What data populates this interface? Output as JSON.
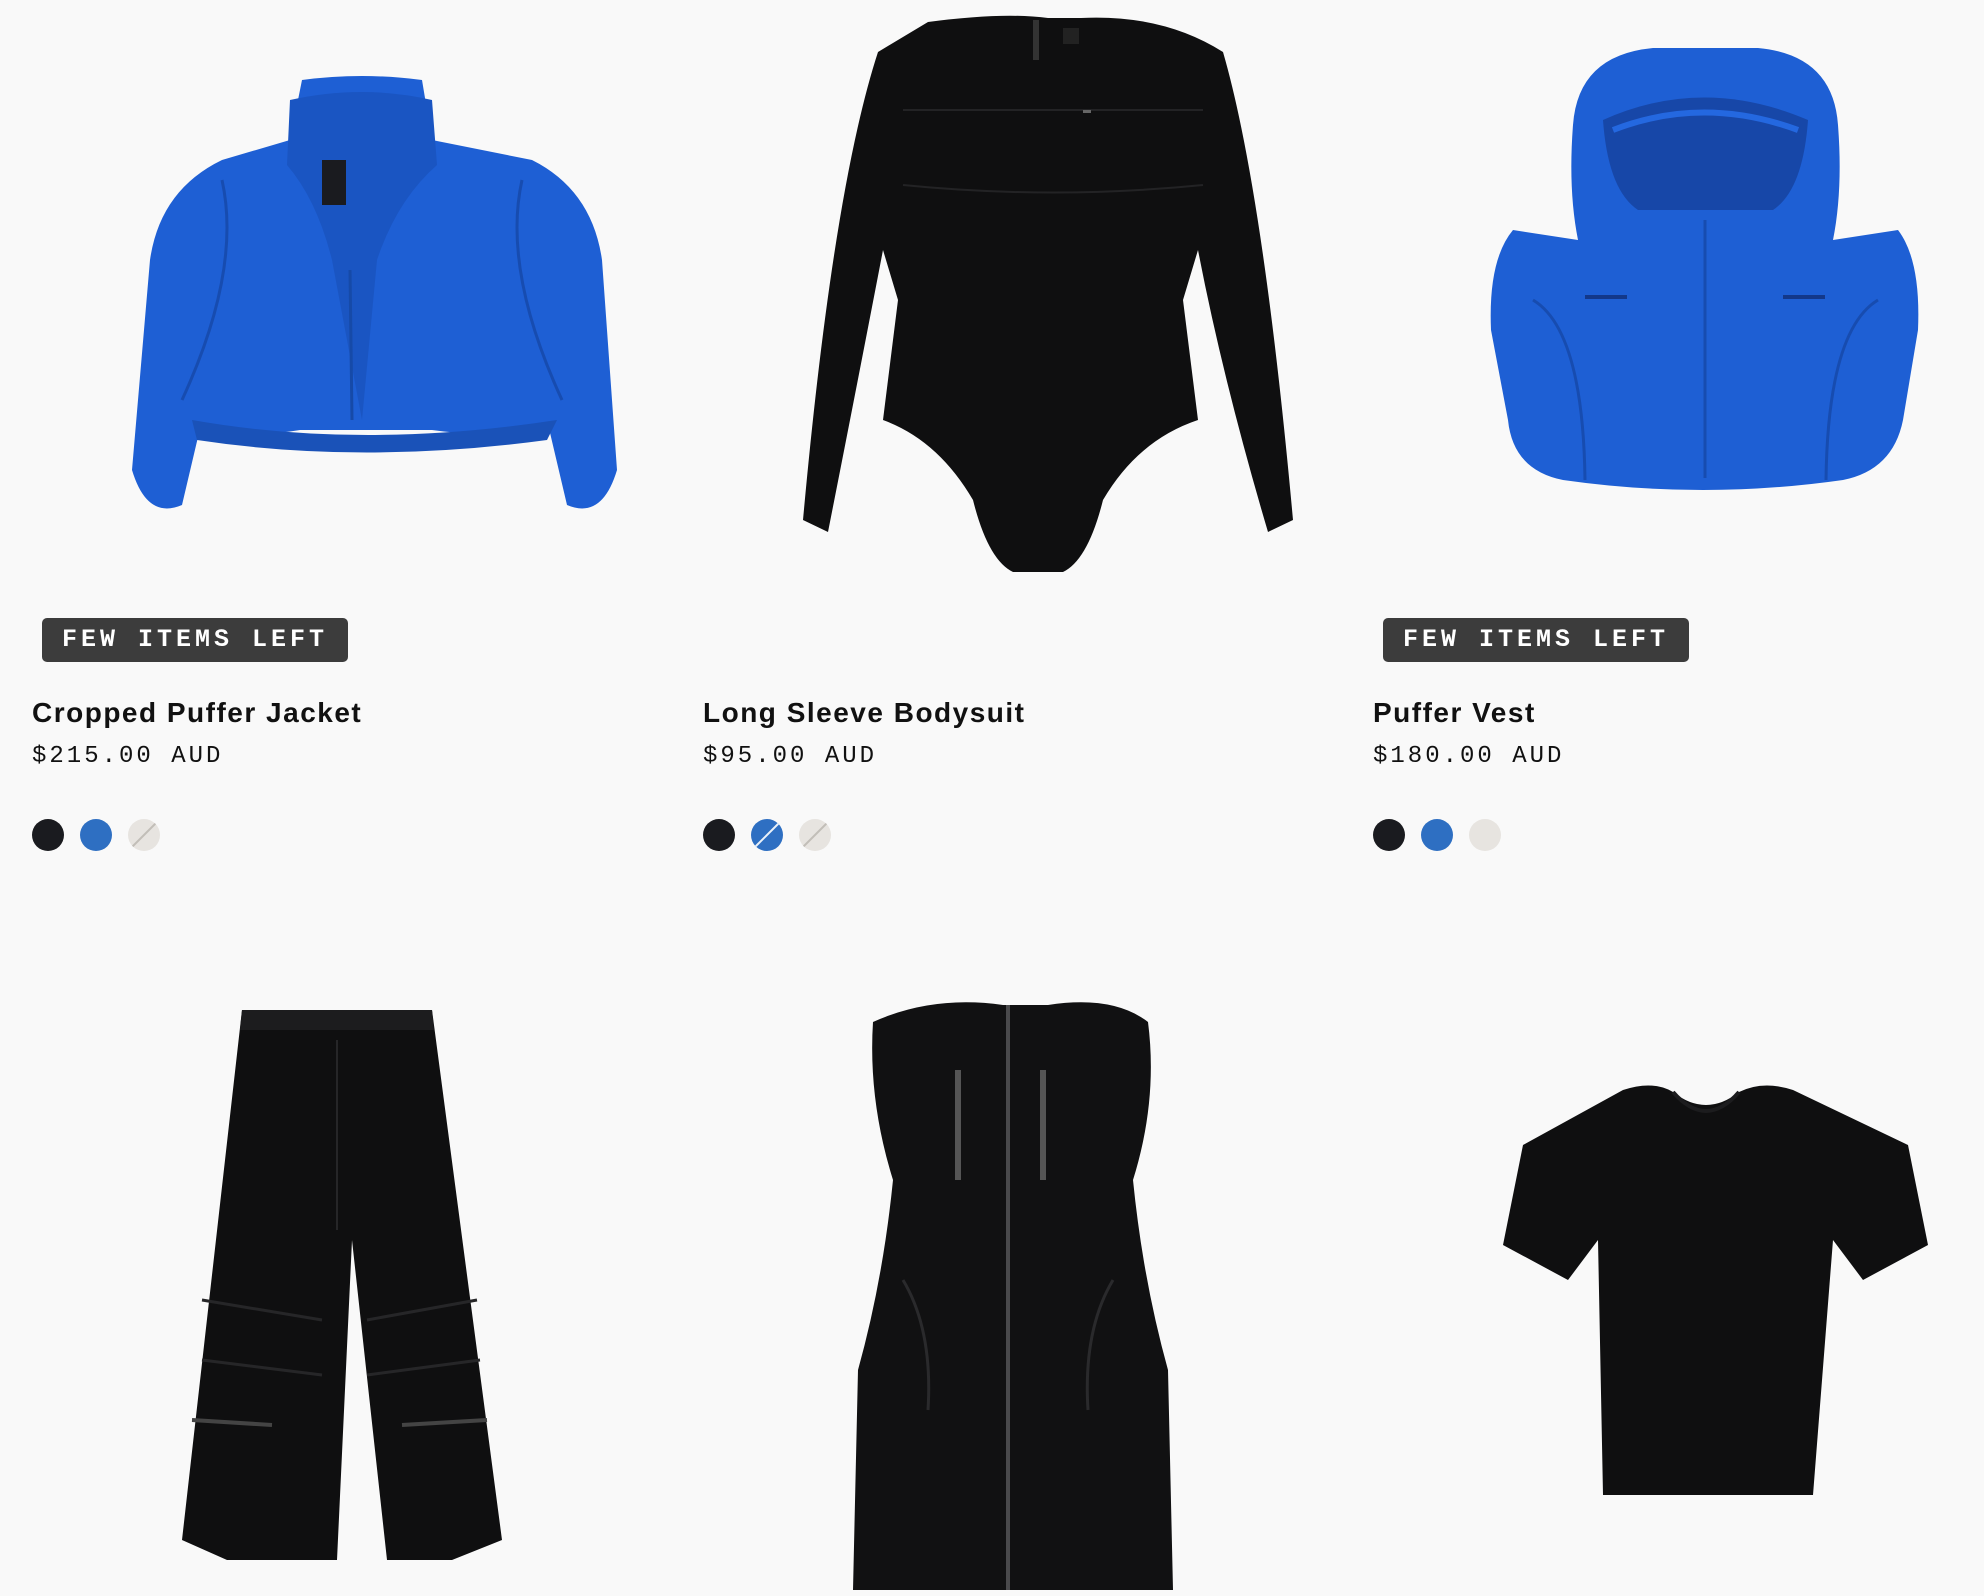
{
  "colors": {
    "page_bg": "#f9f9f9",
    "badge_bg": "#3c3c3c",
    "badge_text": "#ffffff",
    "swatch_black": "#1a1b1f",
    "swatch_blue": "#2e6fc2",
    "swatch_light": "#e7e4e0",
    "garment_blue": "#1e5fd4",
    "garment_black": "#0f0f10"
  },
  "products": [
    {
      "badge": "FEW ITEMS LEFT",
      "name": "Cropped Puffer Jacket",
      "price": "$215.00 AUD",
      "image_icon": "cropped-puffer-jacket-image",
      "swatches": [
        {
          "color": "#1a1b1f",
          "label": "black",
          "unavailable": false
        },
        {
          "color": "#2e6fc2",
          "label": "blue",
          "unavailable": false
        },
        {
          "color": "#e7e4e0",
          "label": "light",
          "unavailable": true
        }
      ]
    },
    {
      "badge": "",
      "name": "Long Sleeve Bodysuit",
      "price": "$95.00 AUD",
      "image_icon": "long-sleeve-bodysuit-image",
      "swatches": [
        {
          "color": "#1a1b1f",
          "label": "black",
          "unavailable": false
        },
        {
          "color": "#2e6fc2",
          "label": "blue",
          "unavailable": true
        },
        {
          "color": "#e7e4e0",
          "label": "light",
          "unavailable": true
        }
      ]
    },
    {
      "badge": "FEW ITEMS LEFT",
      "name": "Puffer Vest",
      "price": "$180.00 AUD",
      "image_icon": "puffer-vest-image",
      "swatches": [
        {
          "color": "#1a1b1f",
          "label": "black",
          "unavailable": false
        },
        {
          "color": "#2e6fc2",
          "label": "blue",
          "unavailable": false
        },
        {
          "color": "#e7e4e0",
          "label": "light",
          "unavailable": false
        }
      ]
    },
    {
      "image_icon": "cargo-pants-image"
    },
    {
      "image_icon": "leather-strapless-dress-image"
    },
    {
      "image_icon": "black-tshirt-image"
    }
  ]
}
